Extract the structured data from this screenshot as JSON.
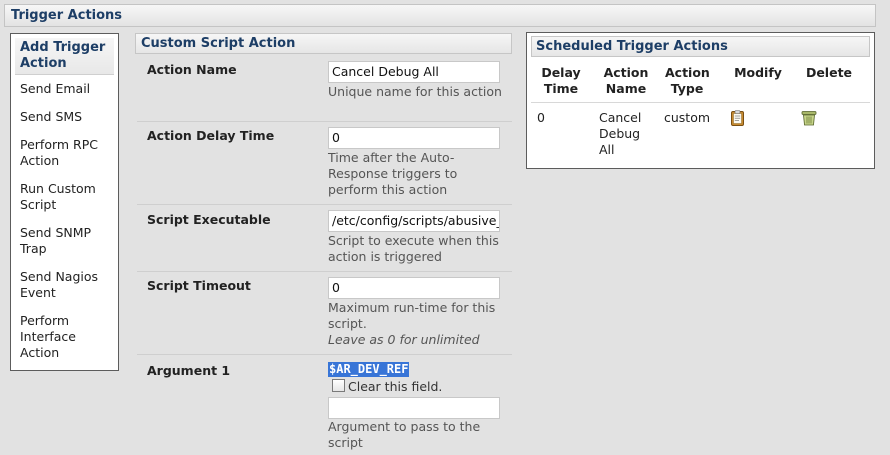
{
  "page": {
    "title": "Trigger Actions"
  },
  "sidebar": {
    "header": "Add Trigger Action",
    "items": [
      {
        "label": "Send Email"
      },
      {
        "label": "Send SMS"
      },
      {
        "label": "Perform RPC Action"
      },
      {
        "label": "Run Custom Script"
      },
      {
        "label": "Send SNMP Trap"
      },
      {
        "label": "Send Nagios Event"
      },
      {
        "label": "Perform Interface Action"
      }
    ]
  },
  "form": {
    "header": "Custom Script Action",
    "action_name": {
      "label": "Action Name",
      "value": "Cancel Debug All",
      "help": "Unique name for this action"
    },
    "delay": {
      "label": "Action Delay Time",
      "value": "0",
      "help": "Time after the Auto-Response triggers to perform this action"
    },
    "script": {
      "label": "Script Executable",
      "value": "/etc/config/scripts/abusive_",
      "help": "Script to execute when this action is triggered"
    },
    "timeout": {
      "label": "Script Timeout",
      "value": "0",
      "help": "Maximum run-time for this script.",
      "help_note": "Leave as 0 for unlimited"
    },
    "argument1": {
      "label": "Argument 1",
      "current_value": "$AR_DEV_REF",
      "clear_label": "Clear this field.",
      "value": "",
      "help": "Argument to pass to the script"
    }
  },
  "scheduled": {
    "header": "Scheduled Trigger Actions",
    "columns": [
      "Delay Time",
      "Action Name",
      "Action Type",
      "Modify",
      "Delete"
    ],
    "rows": [
      {
        "delay": "0",
        "name": "Cancel Debug All",
        "type": "custom",
        "modify_icon": "clipboard-edit-icon",
        "delete_icon": "trash-can-icon"
      }
    ]
  },
  "colors": {
    "heading": "#1d3e66",
    "selection": "#3875d7"
  }
}
